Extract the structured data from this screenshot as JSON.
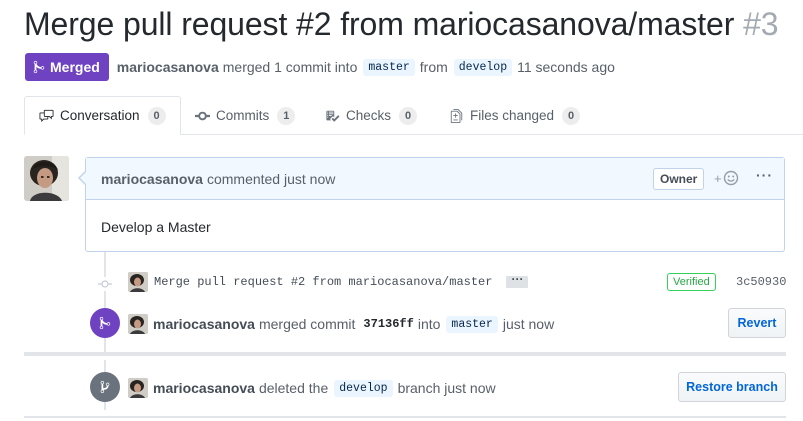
{
  "pr": {
    "title": "Merge pull request #2 from mariocasanova/master",
    "number": "#3",
    "state_label": "Merged",
    "author": "mariocasanova",
    "merged_text": "merged 1 commit into",
    "base_branch": "master",
    "from_text": "from",
    "head_branch": "develop",
    "time": "11 seconds ago"
  },
  "tabs": [
    {
      "label": "Conversation",
      "count": "0",
      "icon": "comment-discussion-icon"
    },
    {
      "label": "Commits",
      "count": "1",
      "icon": "git-commit-icon"
    },
    {
      "label": "Checks",
      "count": "0",
      "icon": "checklist-icon"
    },
    {
      "label": "Files changed",
      "count": "0",
      "icon": "file-diff-icon"
    }
  ],
  "comment": {
    "author": "mariocasanova",
    "action": "commented just now",
    "owner_label": "Owner",
    "reaction_plus": "+",
    "menu": "···",
    "body": "Develop a Master"
  },
  "commit": {
    "message": "Merge pull request #2 from mariocasanova/master",
    "expander": "···",
    "verified": "Verified",
    "sha": "3c50930"
  },
  "merged_event": {
    "author": "mariocasanova",
    "text1": "merged commit",
    "sha": "37136ff",
    "text2": "into",
    "branch": "master",
    "time": "just now",
    "button": "Revert"
  },
  "deleted_event": {
    "author": "mariocasanova",
    "text1": "deleted the",
    "branch": "develop",
    "text2": "branch just now",
    "button": "Restore branch"
  },
  "colors": {
    "merged_purple": "#6f42c1",
    "link_blue": "#0366d6",
    "verified_green": "#28a745",
    "comment_border": "#c0d3eb",
    "comment_header": "#f1f8ff"
  }
}
